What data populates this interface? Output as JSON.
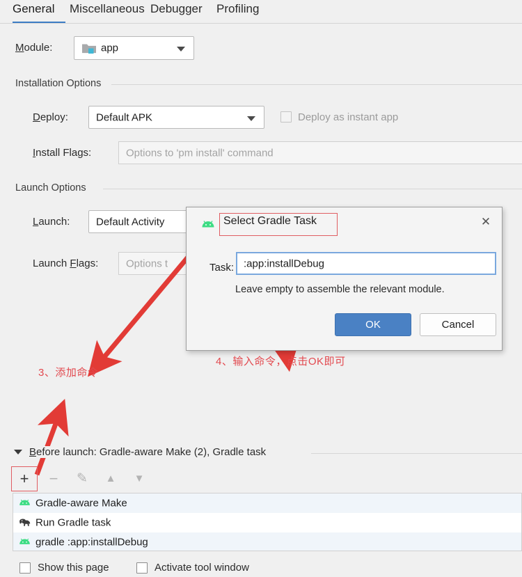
{
  "tabs": [
    {
      "label": "General",
      "active": true
    },
    {
      "label": "Miscellaneous",
      "active": false
    },
    {
      "label": "Debugger",
      "active": false
    },
    {
      "label": "Profiling",
      "active": false
    }
  ],
  "module": {
    "label": "Module:",
    "label_mnemonic": "M",
    "label_rest": "odule:",
    "value": "app",
    "icon": "folder-module-icon"
  },
  "installation_options": {
    "group_title": "Installation Options",
    "deploy": {
      "label_mnemonic": "D",
      "label_rest": "eploy:",
      "value": "Default APK"
    },
    "instant_app_checkbox": {
      "label": "Deploy as instant app",
      "checked": false,
      "disabled": true
    },
    "install_flags": {
      "label_mnemonic": "I",
      "label_rest": "nstall Flags:",
      "value": "",
      "placeholder": "Options to 'pm install' command"
    }
  },
  "launch_options": {
    "group_title": "Launch Options",
    "launch": {
      "label_mnemonic": "L",
      "label_rest": "aunch:",
      "value": "Default Activity"
    },
    "launch_flags": {
      "label_prefix": "Launch ",
      "label_mnemonic": "F",
      "label_rest": "lags:",
      "value": "",
      "placeholder": "Options t"
    }
  },
  "dialog": {
    "title": "Select Gradle Task",
    "icon": "android-icon",
    "close_icon": "close-icon",
    "task_label": "Task:",
    "task_value": ":app:installDebug",
    "hint": "Leave empty to assemble the relevant module.",
    "ok_label": "OK",
    "cancel_label": "Cancel",
    "accent_color": "#4a81c4"
  },
  "annotations": {
    "color": "#e2484e",
    "note_3": "3、添加命令",
    "note_4": "4、输入命令，点击OK即可"
  },
  "before_launch": {
    "title": "Before launch: Gradle-aware Make (2), Gradle task",
    "title_mnemonic": "B",
    "title_rest": "efore launch: Gradle-aware Make (2), Gradle task",
    "toolbar": [
      {
        "name": "add-button",
        "glyph": "+",
        "enabled": true
      },
      {
        "name": "remove-button",
        "glyph": "−",
        "enabled": false
      },
      {
        "name": "edit-button",
        "glyph": "✎",
        "enabled": false
      },
      {
        "name": "move-up-button",
        "glyph": "▲",
        "enabled": false
      },
      {
        "name": "move-down-button",
        "glyph": "▼",
        "enabled": false
      }
    ],
    "items": [
      {
        "icon": "android-icon",
        "label": "Gradle-aware Make"
      },
      {
        "icon": "gradle-elephant-icon",
        "label": "Run Gradle task"
      },
      {
        "icon": "android-icon",
        "label": "gradle :app:installDebug"
      }
    ]
  },
  "footer": {
    "show_this_page": {
      "label": "Show this page",
      "checked": false
    },
    "activate_tool_window": {
      "label": "Activate tool window",
      "checked": false
    }
  }
}
